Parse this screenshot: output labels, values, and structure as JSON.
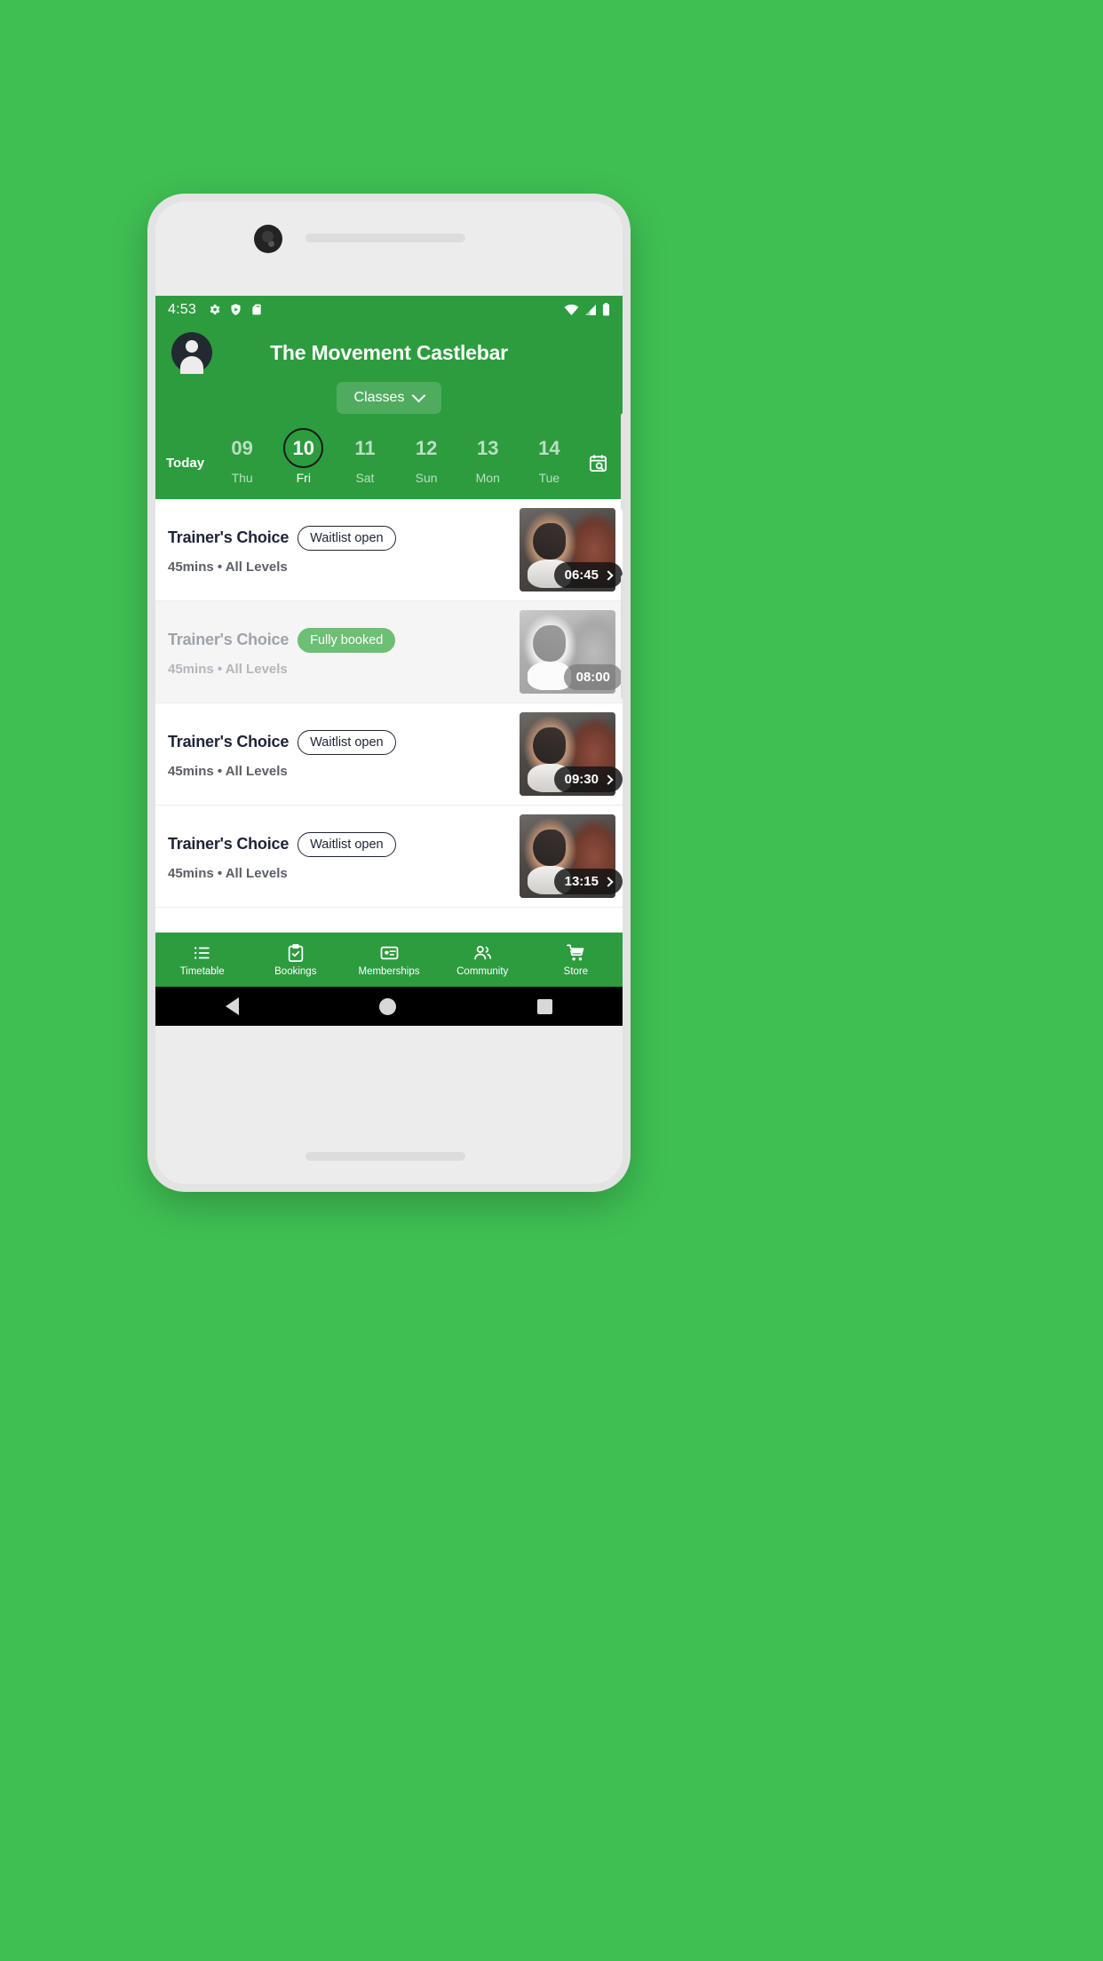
{
  "status_bar": {
    "time": "4:53",
    "left_icons": [
      "gear-icon",
      "shield-play-icon",
      "sd-card-icon"
    ],
    "right_icons": [
      "wifi-icon",
      "signal-icon",
      "battery-icon"
    ]
  },
  "header": {
    "title": "The Movement Castlebar",
    "avatar": "user-avatar-icon",
    "filter_label": "Classes",
    "filter_caret": "chevron-down-icon"
  },
  "date_strip": {
    "today_label": "Today",
    "calendar_icon": "calendar-search-icon",
    "days": [
      {
        "num": "09",
        "dow": "Thu",
        "selected": false
      },
      {
        "num": "10",
        "dow": "Fri",
        "selected": true
      },
      {
        "num": "11",
        "dow": "Sat",
        "selected": false
      },
      {
        "num": "12",
        "dow": "Sun",
        "selected": false
      },
      {
        "num": "13",
        "dow": "Mon",
        "selected": false
      },
      {
        "num": "14",
        "dow": "Tue",
        "selected": false
      }
    ]
  },
  "classes": [
    {
      "title": "Trainer's Choice",
      "badge": "Waitlist open",
      "badge_style": "outline",
      "subtitle": "45mins • All Levels",
      "time": "06:45",
      "disabled": false,
      "has_chevron": true
    },
    {
      "title": "Trainer's Choice",
      "badge": "Fully booked",
      "badge_style": "filled",
      "subtitle": "45mins • All Levels",
      "time": "08:00",
      "disabled": true,
      "has_chevron": false
    },
    {
      "title": "Trainer's Choice",
      "badge": "Waitlist open",
      "badge_style": "outline",
      "subtitle": "45mins • All Levels",
      "time": "09:30",
      "disabled": false,
      "has_chevron": true
    },
    {
      "title": "Trainer's Choice",
      "badge": "Waitlist open",
      "badge_style": "outline",
      "subtitle": "45mins • All Levels",
      "time": "13:15",
      "disabled": false,
      "has_chevron": true
    }
  ],
  "bottom_nav": [
    {
      "label": "Timetable",
      "icon": "list-icon",
      "active": true
    },
    {
      "label": "Bookings",
      "icon": "clipboard-check-icon",
      "active": false
    },
    {
      "label": "Memberships",
      "icon": "card-star-icon",
      "active": false
    },
    {
      "label": "Community",
      "icon": "people-icon",
      "active": false
    },
    {
      "label": "Store",
      "icon": "shopping-cart-icon",
      "active": false
    }
  ],
  "android_nav": {
    "back": "back-triangle-icon",
    "home": "home-circle-icon",
    "recents": "recents-square-icon"
  },
  "colors": {
    "brand_green": "#2c9c3e",
    "page_green": "#3fbf52",
    "badge_filled": "#6cbf73",
    "title_navy": "#1d2438"
  }
}
